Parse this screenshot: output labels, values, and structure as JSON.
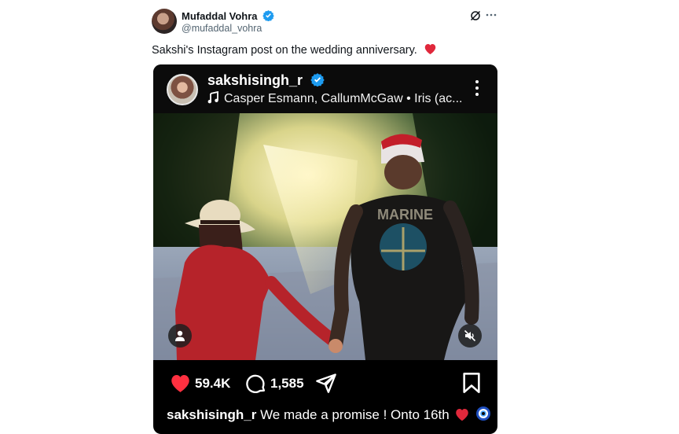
{
  "tweet": {
    "author_name": "Mufaddal Vohra",
    "author_handle": "@mufaddal_vohra",
    "text": "Sakshi's Instagram post on the wedding anniversary.",
    "text_emoji": "red-heart-emoji"
  },
  "instagram": {
    "username": "sakshisingh_r",
    "music": "Casper Esmann, CallumMcGaw • Iris (ac...",
    "likes": "59.4K",
    "comments": "1,585",
    "caption_user": "sakshisingh_r",
    "caption_text": "We made a promise ! Onto 16th",
    "caption_emojis": [
      "red-heart-emoji",
      "nazar-amulet-emoji"
    ],
    "shirt_print": "MARINE"
  },
  "colors": {
    "verified_blue": "#1d9bf0",
    "like_red": "#ff3040",
    "card_bg": "#000000",
    "handle_gray": "#536471"
  }
}
